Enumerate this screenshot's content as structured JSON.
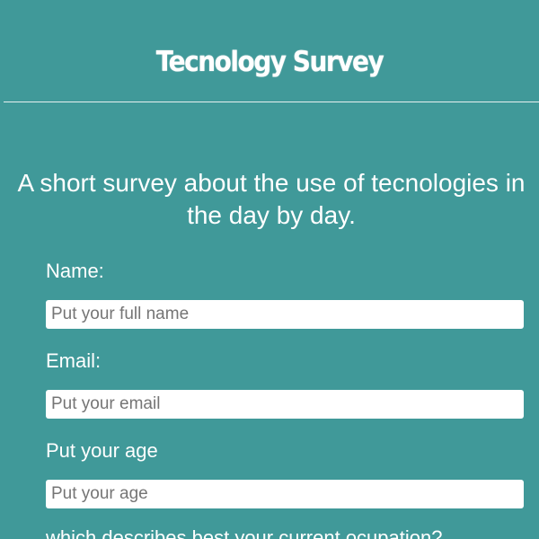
{
  "header": {
    "title": "Tecnology Survey"
  },
  "intro": {
    "description": "A short survey about the use of tecnologies in the day by day."
  },
  "form": {
    "name": {
      "label": "Name:",
      "placeholder": "Put your full name",
      "value": ""
    },
    "email": {
      "label": "Email:",
      "placeholder": "Put your email",
      "value": ""
    },
    "age": {
      "label": "Put your age",
      "placeholder": "Put your age",
      "value": ""
    },
    "occupation": {
      "label": "which describes best your current ocupation?"
    }
  },
  "colors": {
    "background": "#409999",
    "text": "#ffffff",
    "input_background": "#ffffff",
    "placeholder": "#757575"
  }
}
